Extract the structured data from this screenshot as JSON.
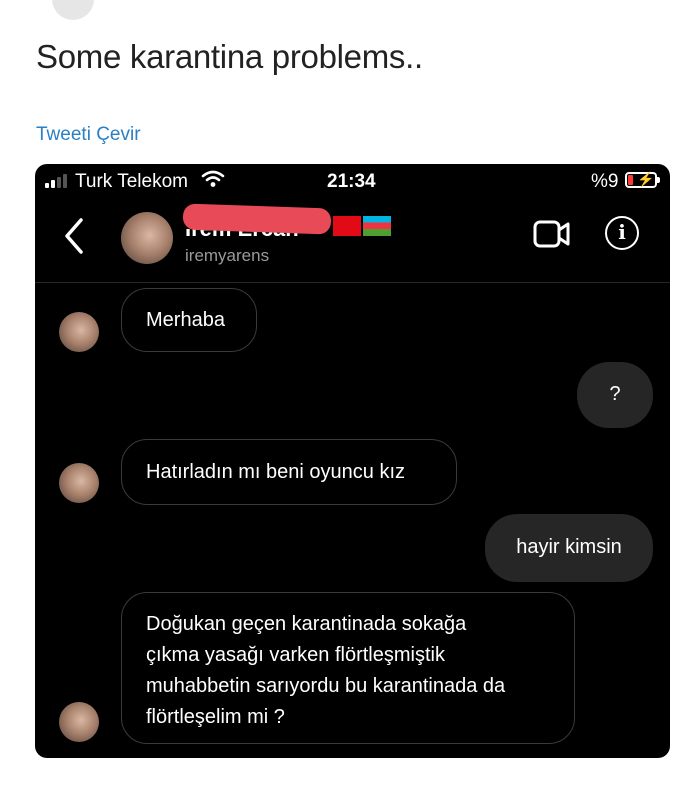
{
  "tweet": {
    "text": "Some karantina problems..",
    "translate_label": "Tweeti Çevir"
  },
  "status_bar": {
    "carrier": "Turk Telekom",
    "time": "21:34",
    "battery": "%9"
  },
  "chat_header": {
    "display_name": "İrem Ercan",
    "username": "iremyarens"
  },
  "messages": [
    {
      "side": "in",
      "text": "Merhaba"
    },
    {
      "side": "out",
      "text": "?"
    },
    {
      "side": "in",
      "text": "Hatırladın mı beni oyuncu kız"
    },
    {
      "side": "out",
      "text": "hayir kimsin"
    },
    {
      "side": "in",
      "text": "Doğukan geçen  karantinada sokağa\nçıkma yasağı varken flörtleşmiştik\nmuhabbetin sarıyordu bu karantinada da\nflörtleşelim mi ?"
    }
  ],
  "colors": {
    "link": "#2b7fc4",
    "redaction": "#e84a58",
    "outgoing_bubble": "#262626",
    "battery_low": "#ff3b30"
  }
}
